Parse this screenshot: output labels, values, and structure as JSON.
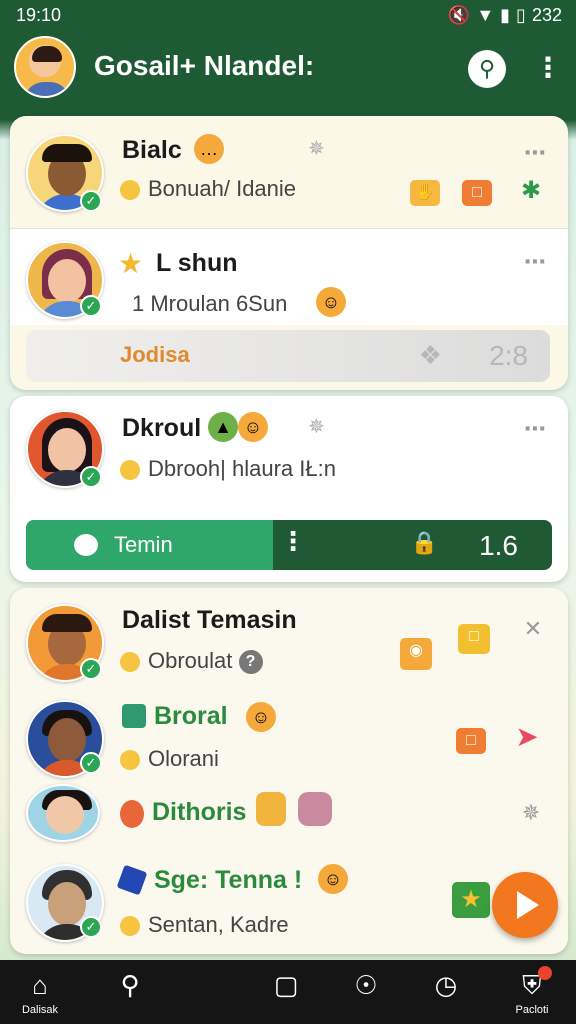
{
  "status_bar": {
    "time": "19:10",
    "battery_text": "232"
  },
  "app_bar": {
    "title": "Gosail+ Nlandel:"
  },
  "chats": [
    {
      "name": "Bialc",
      "preview": "Bonuah/ Idanie"
    },
    {
      "name": "L shun",
      "preview": "1 Mroulan 6Sun"
    },
    {
      "name": "Dkroul",
      "preview": "Dbrooh| hlaura IŁ:n"
    },
    {
      "name": "Dalist Temasin",
      "preview": "Obroulat"
    },
    {
      "name": "Broral",
      "preview": "Olorani"
    },
    {
      "name": "Dithoris",
      "preview": ""
    },
    {
      "name": "Sge: Tenna !",
      "preview": "Sentan, Kadre"
    }
  ],
  "pills": {
    "grey": {
      "label": "Jodisa",
      "value": "2:8"
    },
    "progress": {
      "label": "Temin",
      "value": "1.6",
      "fraction": 0.47
    }
  },
  "bottom_nav": [
    {
      "id": "home",
      "label": "Dalisak"
    },
    {
      "id": "search",
      "label": ""
    },
    {
      "id": "square",
      "label": ""
    },
    {
      "id": "compass",
      "label": ""
    },
    {
      "id": "timer",
      "label": ""
    },
    {
      "id": "profile",
      "label": "Pacloti"
    }
  ],
  "colors": {
    "brand_green": "#1e5a34",
    "accent_green": "#2fa66a",
    "orange": "#f2771f"
  }
}
